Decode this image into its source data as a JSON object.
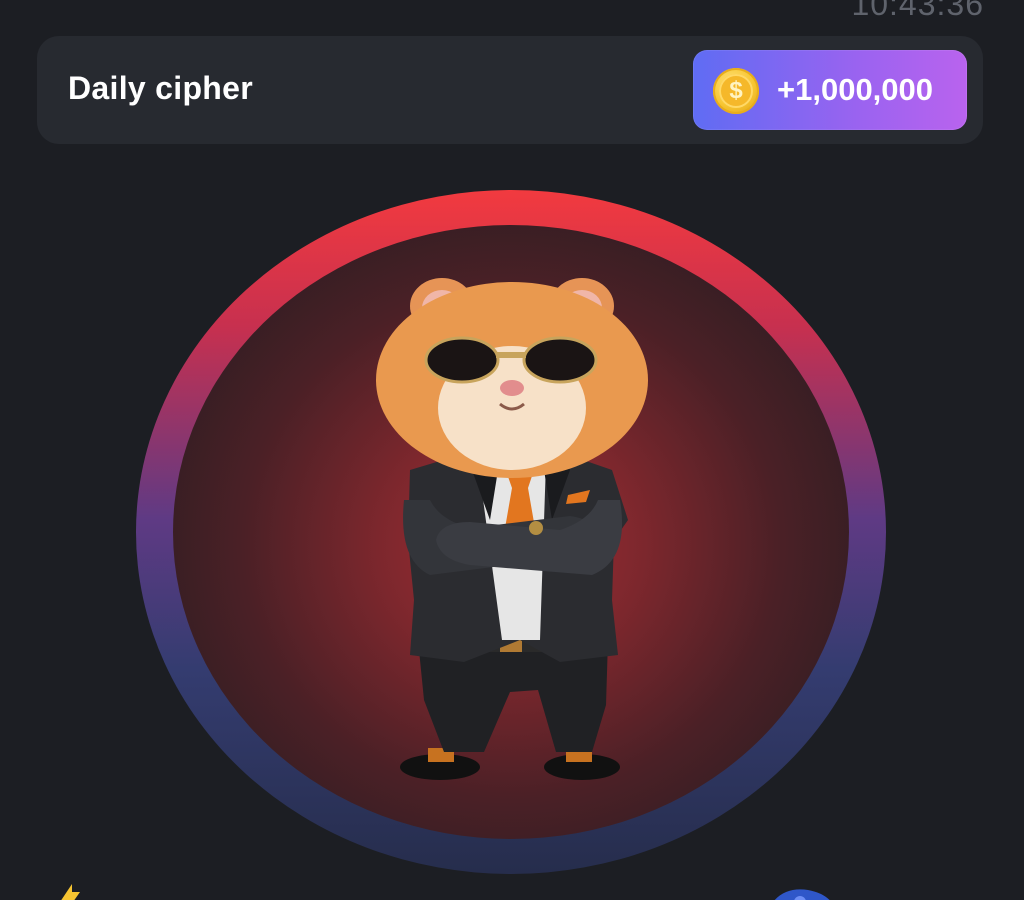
{
  "status": {
    "timer_text": "10:43:36"
  },
  "cipher": {
    "title": "Daily cipher",
    "reward_label": "+1,000,000",
    "coin_symbol": "$"
  },
  "tap_area": {
    "character": "hamster-ceo"
  },
  "colors": {
    "background": "#1c1e23",
    "card": "#272a30",
    "reward_gradient_start": "#5f6cf3",
    "reward_gradient_end": "#b963ee",
    "ring_top": "#f23a3f",
    "ring_bottom": "#262d4c",
    "coin": "#f7c531"
  }
}
